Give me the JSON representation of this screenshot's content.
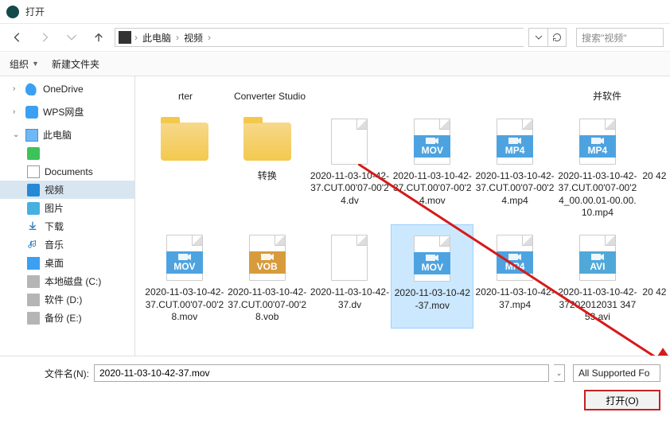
{
  "title": "打开",
  "breadcrumb": {
    "root": "此电脑",
    "folder": "视频"
  },
  "search_placeholder": "搜索\"视频\"",
  "toolbar": {
    "organize": "组织",
    "newfolder": "新建文件夹"
  },
  "sidebar": {
    "onedrive": "OneDrive",
    "wps": "WPS网盘",
    "thispc": "此电脑",
    "green": "",
    "documents": "Documents",
    "video": "视频",
    "pictures": "图片",
    "downloads": "下载",
    "music": "音乐",
    "desktop": "桌面",
    "diskc": "本地磁盘 (C:)",
    "diskd": "软件 (D:)",
    "diske": "备份 (E:)"
  },
  "row0": {
    "c0": "rter",
    "c1": "Converter Studio",
    "c4": "并软件"
  },
  "row1": {
    "c0": "",
    "c1": "转换",
    "c2": "2020-11-03-10-42-37.CUT.00'07-00'24.dv",
    "c3": "2020-11-03-10-42-37.CUT.00'07-00'24.mov",
    "c4": "2020-11-03-10-42-37.CUT.00'07-00'24.mp4",
    "c5": "2020-11-03-10-42-37.CUT.00'07-00'24_00.00.01-00.00.10.mp4",
    "c6": "20\n42"
  },
  "row2": {
    "c0": "2020-11-03-10-42-37.CUT.00'07-00'28.mov",
    "c1": "2020-11-03-10-42-37.CUT.00'07-00'28.vob",
    "c2": "2020-11-03-10-42-37.dv",
    "c3": "2020-11-03-10-42-37.mov",
    "c4": "2020-11-03-10-42-37.mp4",
    "c5": "2020-11-03-10-42-37202012031\n34753.avi",
    "c6": "20\n42"
  },
  "badges": {
    "mov": "MOV",
    "mp4": "MP4",
    "vob": "VOB",
    "avi": "AVI"
  },
  "footer": {
    "label": "文件名(N):",
    "value": "2020-11-03-10-42-37.mov",
    "filter": "All Supported Fo",
    "open": "打开(O)"
  }
}
